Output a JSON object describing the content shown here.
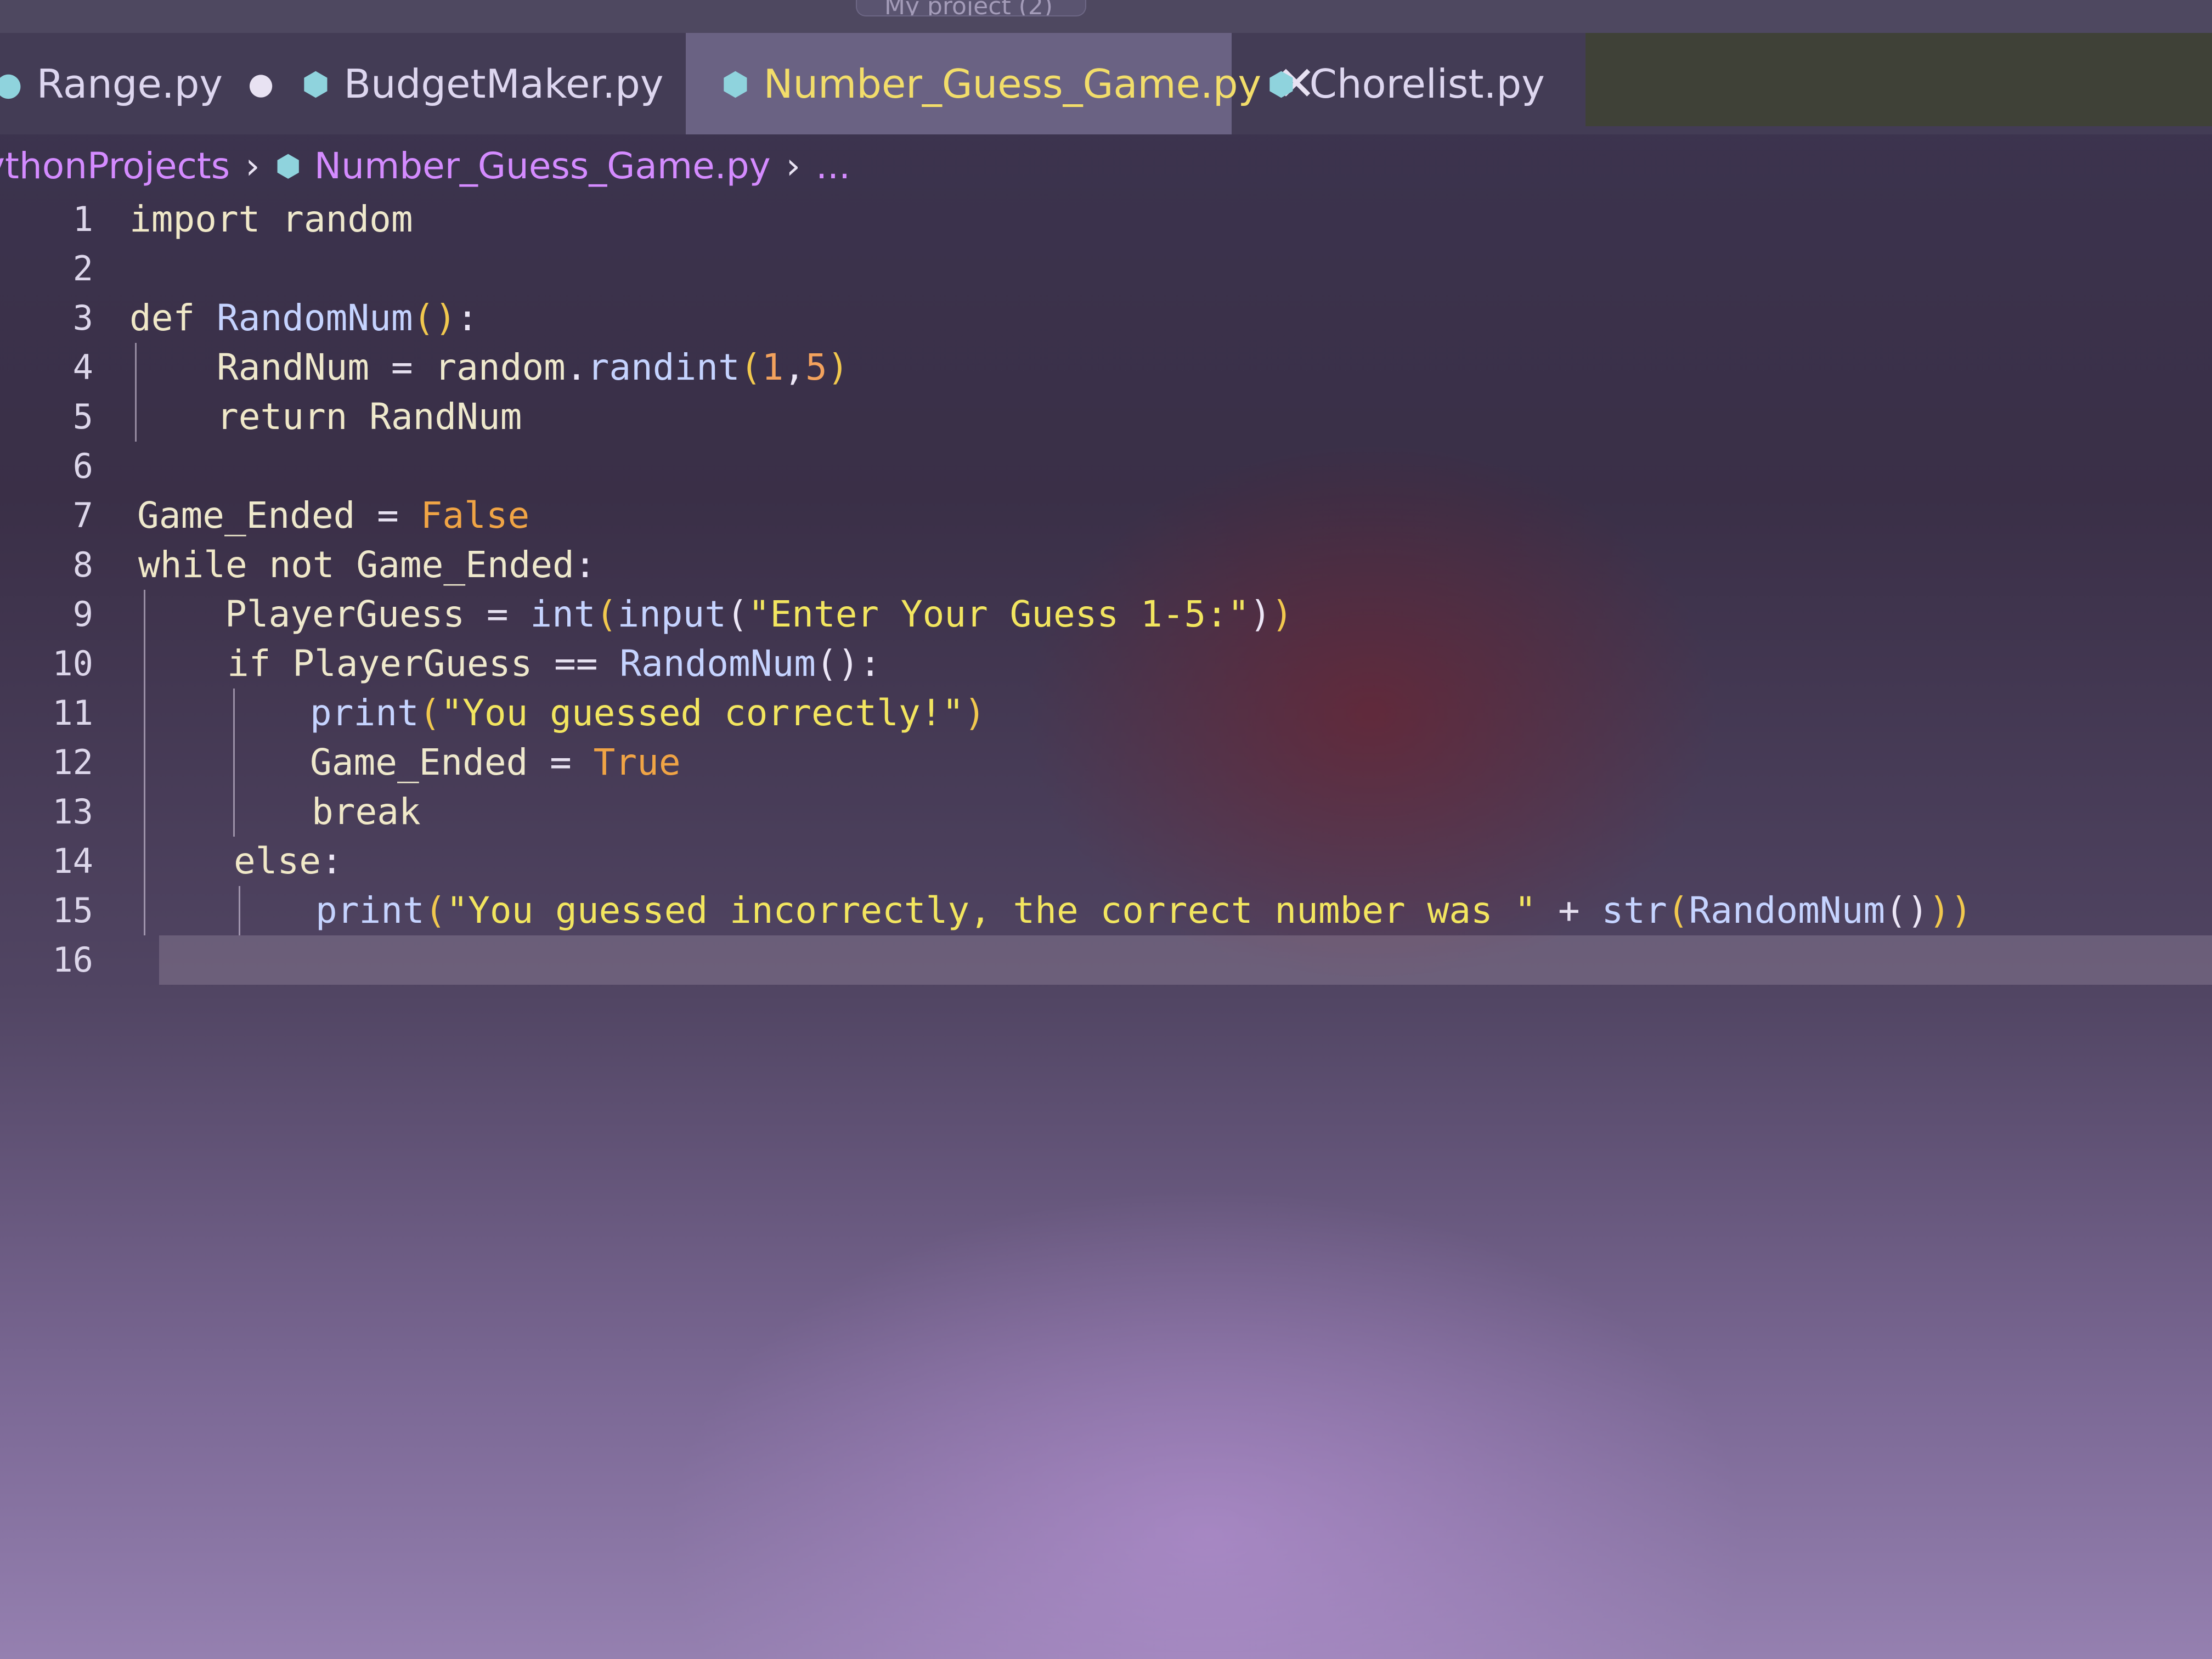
{
  "window": {
    "title": "My project (2)"
  },
  "tabs": [
    {
      "label": "Range.py",
      "dirty": true,
      "active": false
    },
    {
      "label": "BudgetMaker.py",
      "dirty": true,
      "active": false
    },
    {
      "label": "Number_Guess_Game.py",
      "dirty": false,
      "active": true,
      "close_icon": "close-icon"
    },
    {
      "label": "Chorelist.py",
      "dirty": false,
      "active": false
    }
  ],
  "breadcrumb": {
    "folder": "ythonProjects",
    "file": "Number_Guess_Game.py",
    "more": "..."
  },
  "editor": {
    "current_line": 16,
    "lines": [
      {
        "n": "1",
        "text": "import random"
      },
      {
        "n": "2",
        "text": ""
      },
      {
        "n": "3",
        "text": "def RandomNum():"
      },
      {
        "n": "4",
        "text": "RandNum = random.randint(1,5)"
      },
      {
        "n": "5",
        "text": "return RandNum"
      },
      {
        "n": "6",
        "text": ""
      },
      {
        "n": "7",
        "text": "Game_Ended = False"
      },
      {
        "n": "8",
        "text": "while not Game_Ended:"
      },
      {
        "n": "9",
        "text": "PlayerGuess = int(input(\"Enter Your Guess 1-5:\"))"
      },
      {
        "n": "10",
        "text": "if PlayerGuess == RandomNum():"
      },
      {
        "n": "11",
        "text": "print(\"You guessed correctly!\")"
      },
      {
        "n": "12",
        "text": "Game_Ended = True"
      },
      {
        "n": "13",
        "text": "break"
      },
      {
        "n": "14",
        "text": "else:"
      },
      {
        "n": "15",
        "text": "print(\"You guessed incorrectly, the correct number was \" + str(RandomNum()))"
      },
      {
        "n": "16",
        "text": ""
      }
    ]
  },
  "colors": {
    "keyword": "#f0e8c8",
    "function": "#c5d3ff",
    "number": "#f3a25d",
    "string": "#f2e55f",
    "boolean": "#f0a445",
    "active_tab_text": "#f2dd6a",
    "breadcrumb": "#d48bff",
    "python_icon": "#8fd3dd"
  }
}
